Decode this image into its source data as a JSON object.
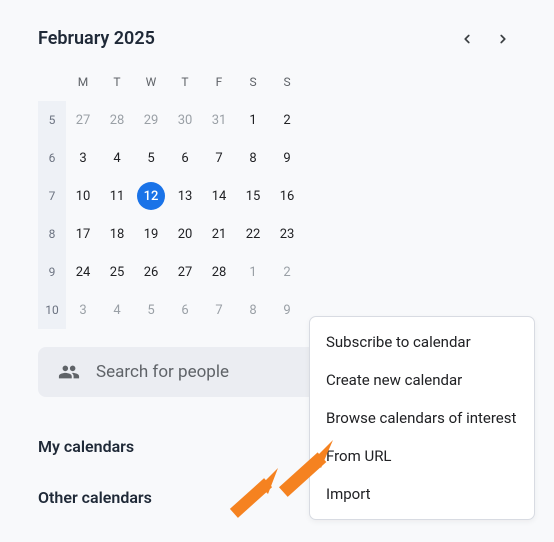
{
  "calendar": {
    "title": "February 2025",
    "dow": [
      "M",
      "T",
      "W",
      "T",
      "F",
      "S",
      "S"
    ],
    "weeks": [
      {
        "num": "5",
        "days": [
          {
            "n": "27",
            "other": true
          },
          {
            "n": "28",
            "other": true
          },
          {
            "n": "29",
            "other": true
          },
          {
            "n": "30",
            "other": true
          },
          {
            "n": "31",
            "other": true
          },
          {
            "n": "1"
          },
          {
            "n": "2"
          }
        ]
      },
      {
        "num": "6",
        "days": [
          {
            "n": "3"
          },
          {
            "n": "4"
          },
          {
            "n": "5"
          },
          {
            "n": "6"
          },
          {
            "n": "7"
          },
          {
            "n": "8"
          },
          {
            "n": "9"
          }
        ]
      },
      {
        "num": "7",
        "days": [
          {
            "n": "10"
          },
          {
            "n": "11"
          },
          {
            "n": "12",
            "selected": true
          },
          {
            "n": "13"
          },
          {
            "n": "14"
          },
          {
            "n": "15"
          },
          {
            "n": "16"
          }
        ]
      },
      {
        "num": "8",
        "days": [
          {
            "n": "17"
          },
          {
            "n": "18"
          },
          {
            "n": "19"
          },
          {
            "n": "20"
          },
          {
            "n": "21"
          },
          {
            "n": "22"
          },
          {
            "n": "23"
          }
        ]
      },
      {
        "num": "9",
        "days": [
          {
            "n": "24"
          },
          {
            "n": "25"
          },
          {
            "n": "26"
          },
          {
            "n": "27"
          },
          {
            "n": "28"
          },
          {
            "n": "1",
            "other": true
          },
          {
            "n": "2",
            "other": true
          }
        ]
      },
      {
        "num": "10",
        "days": [
          {
            "n": "3",
            "other": true
          },
          {
            "n": "4",
            "other": true
          },
          {
            "n": "5",
            "other": true
          },
          {
            "n": "6",
            "other": true
          },
          {
            "n": "7",
            "other": true
          },
          {
            "n": "8",
            "other": true
          },
          {
            "n": "9",
            "other": true
          }
        ]
      }
    ]
  },
  "search": {
    "placeholder": "Search for people"
  },
  "sections": {
    "my": "My calendars",
    "other": "Other calendars"
  },
  "menu": [
    "Subscribe to calendar",
    "Create new calendar",
    "Browse calendars of interest",
    "From URL",
    "Import"
  ]
}
